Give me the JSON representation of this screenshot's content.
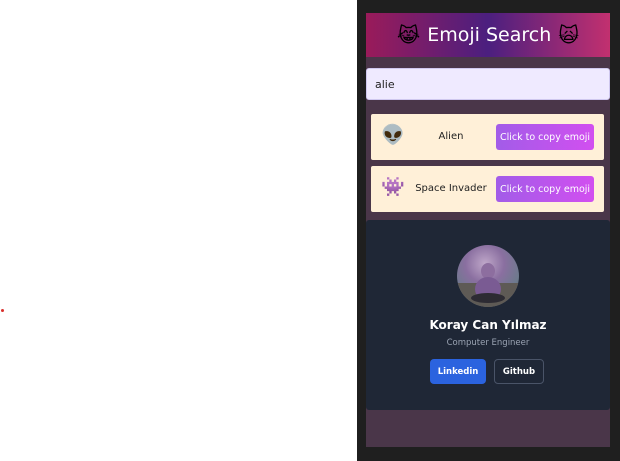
{
  "header": {
    "title": "Emoji Search",
    "left_emoji": "😹",
    "right_emoji": "🙀"
  },
  "search": {
    "value": "alie",
    "placeholder": ""
  },
  "results": [
    {
      "emoji": "👽",
      "name": "Alien",
      "button_label": "Click to copy emoji"
    },
    {
      "emoji": "👾",
      "name": "Space Invader",
      "button_label": "Click to copy emoji"
    }
  ],
  "profile": {
    "name": "Koray Can Yılmaz",
    "role": "Computer Engineer",
    "linkedin_label": "Linkedin",
    "github_label": "Github"
  },
  "colors": {
    "header_gradient": [
      "#9a1b5a",
      "#4b1f7f",
      "#c2306f"
    ],
    "card_bg": "#fff0d8",
    "copy_button": "#a25ce8",
    "profile_bg": "#1f2736",
    "linkedin_button": "#2b63df"
  }
}
